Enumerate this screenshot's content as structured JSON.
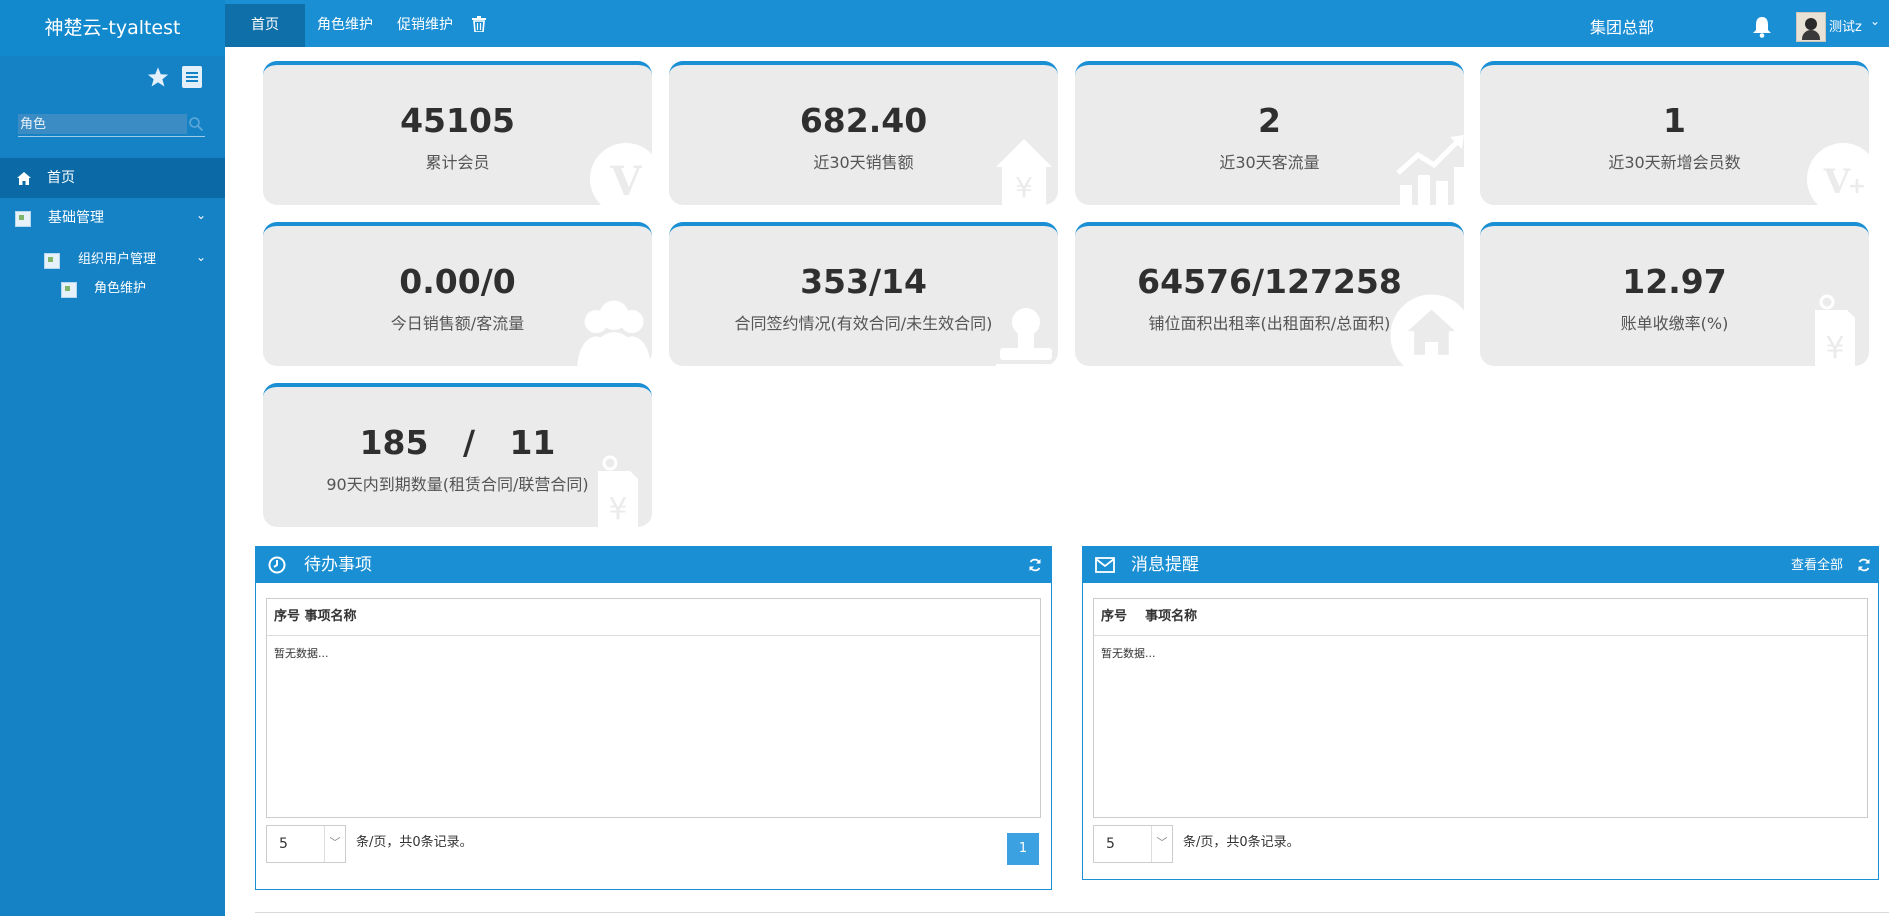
{
  "app": {
    "brand": "神楚云-tyaltest"
  },
  "topnav": {
    "tabs": [
      {
        "label": "首页",
        "active": true
      },
      {
        "label": "角色维护",
        "active": false
      },
      {
        "label": "促销维护",
        "active": false
      }
    ],
    "trash_icon": "trash-icon",
    "org_name": "集团总部",
    "bell_icon": "bell-icon",
    "user_name": "测试z",
    "caret": "⌄"
  },
  "sidebar": {
    "search_placeholder": "角色",
    "items": [
      {
        "label": "首页",
        "icon": "home-icon",
        "active": true
      },
      {
        "label": "基础管理",
        "icon": "broken-image-icon",
        "expanded": true
      },
      {
        "label": "组织用户管理",
        "icon": "broken-image-icon",
        "expanded": true
      },
      {
        "label": "角色维护",
        "icon": "broken-image-icon"
      }
    ],
    "chevron": "⌄"
  },
  "cards": [
    {
      "value": "45105",
      "label": "累计会员",
      "icon": "vip-icon"
    },
    {
      "value": "682.40",
      "label": "近30天销售额",
      "icon": "yen-house-icon"
    },
    {
      "value": "2",
      "label": "近30天客流量",
      "icon": "growth-chart-icon"
    },
    {
      "value": "1",
      "label": "近30天新增会员数",
      "icon": "vip-plus-icon"
    },
    {
      "value": "0.00/0",
      "label": "今日销售额/客流量",
      "icon": "users-icon"
    },
    {
      "value": "353/14",
      "label": "合同签约情况(有效合同/未生效合同)",
      "icon": "stamp-icon"
    },
    {
      "value": "64576/127258",
      "label": "铺位面积出租率(出租面积/总面积)",
      "icon": "home-icon"
    },
    {
      "value": "12.97",
      "label": "账单收缴率(%)",
      "icon": "yen-tag-icon"
    },
    {
      "value": "185   /   11",
      "label": "90天内到期数量(租赁合同/联营合同)",
      "icon": "yen-tag-icon"
    }
  ],
  "panels": {
    "todo": {
      "title": "待办事项",
      "icon": "clock-icon",
      "columns": "序号 事项名称",
      "empty_text": "暂无数据...",
      "page_size": "5",
      "pager_info": "条/页，共0条记录。",
      "current_page": "1"
    },
    "messages": {
      "title": "消息提醒",
      "icon": "envelope-icon",
      "view_all": "查看全部",
      "columns": "序号    事项名称",
      "empty_text": "暂无数据...",
      "page_size": "5",
      "pager_info": "条/页，共0条记录。"
    }
  },
  "colors": {
    "primary": "#1a8fd4",
    "sidebar": "#1682c6",
    "active": "#0b6aa6",
    "card_bg": "#ebebeb"
  }
}
